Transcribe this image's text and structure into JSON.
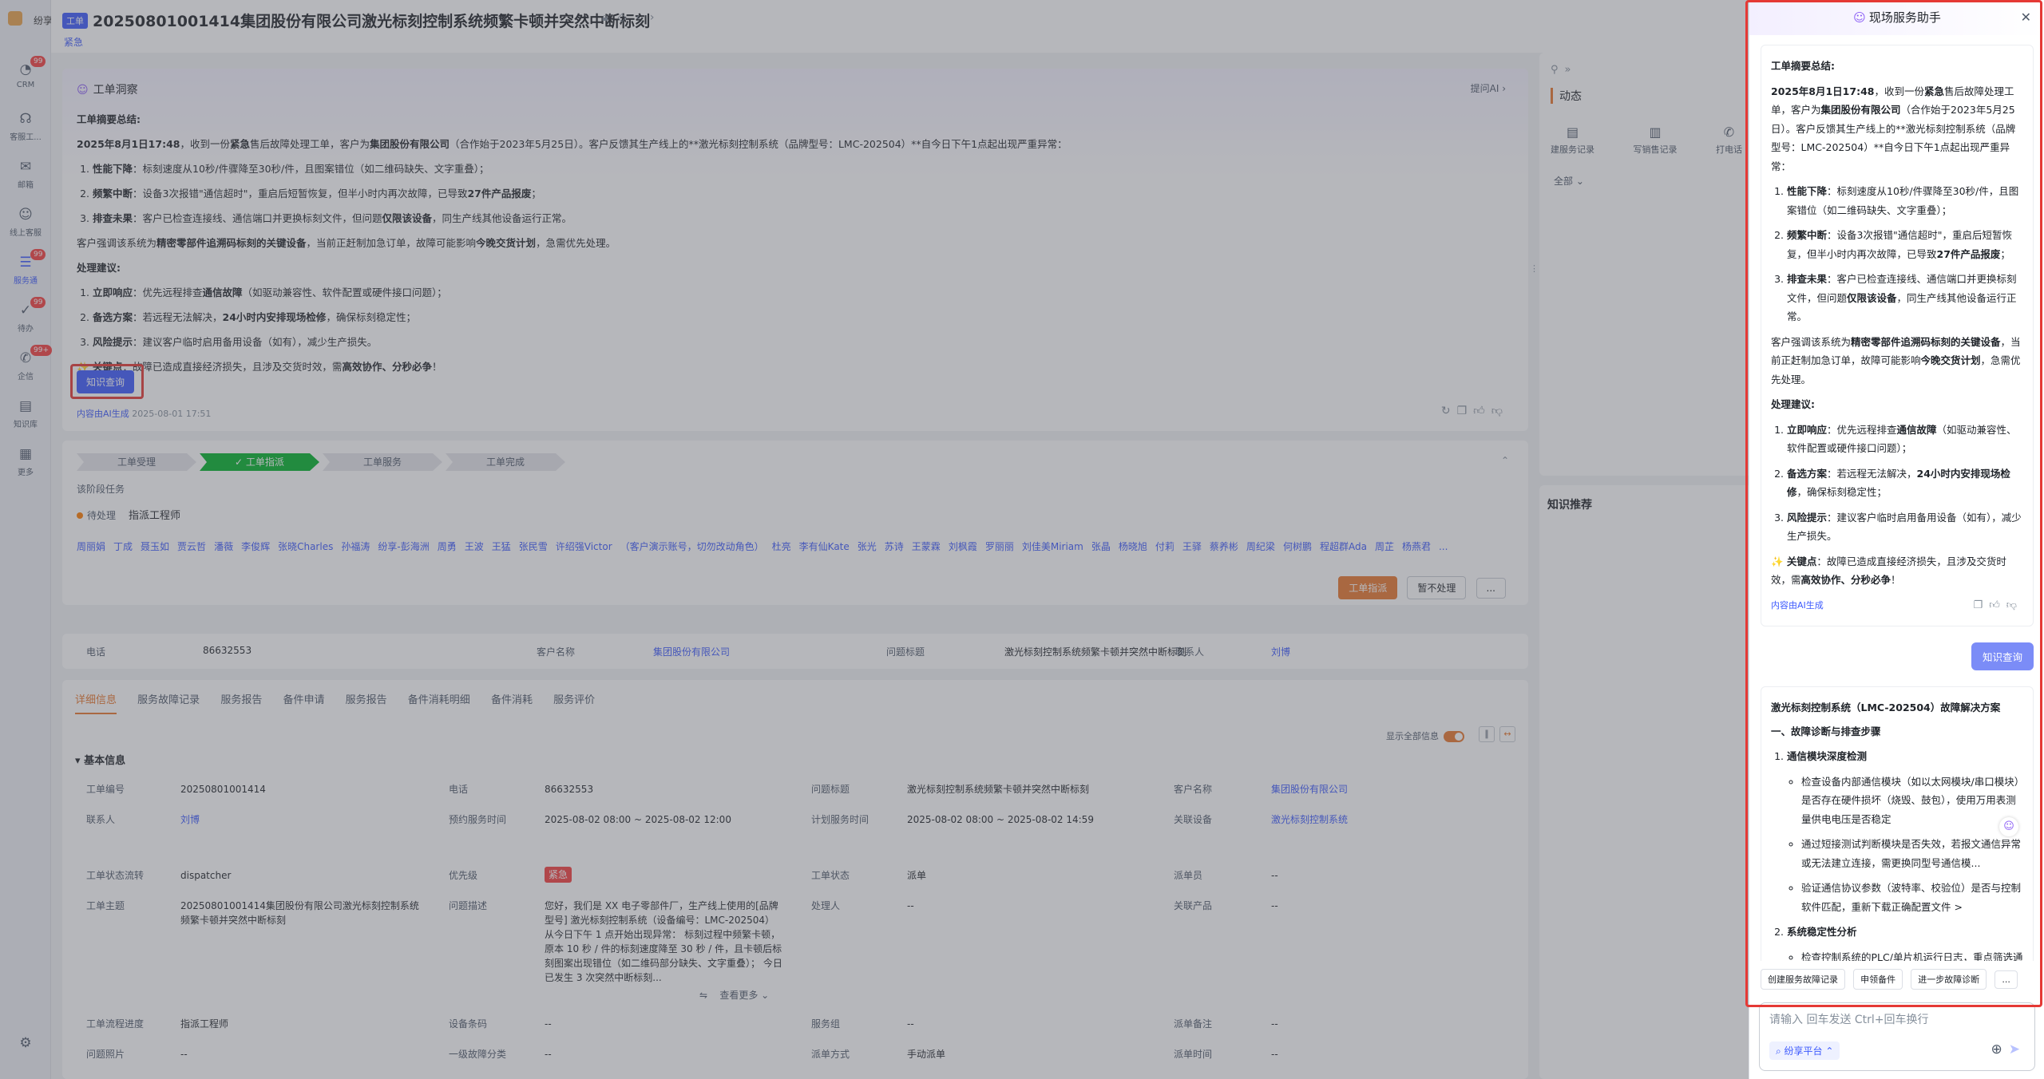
{
  "nav": {
    "brand": "纷享",
    "items": [
      {
        "label": "CRM",
        "icon": "crm-icon",
        "badge": "99"
      },
      {
        "label": "客服工...",
        "icon": "headset-icon",
        "badge": ""
      },
      {
        "label": "邮箱",
        "icon": "mail-icon",
        "badge": ""
      },
      {
        "label": "线上客服",
        "icon": "chat-icon",
        "badge": ""
      },
      {
        "label": "服务通",
        "icon": "service-icon",
        "badge": "99"
      },
      {
        "label": "待办",
        "icon": "todo-icon",
        "badge": "99"
      },
      {
        "label": "企信",
        "icon": "message-icon",
        "badge": "99+"
      },
      {
        "label": "知识库",
        "icon": "book-icon",
        "badge": ""
      },
      {
        "label": "更多",
        "icon": "grid-icon",
        "badge": ""
      }
    ],
    "settings_icon": "gear-icon"
  },
  "header": {
    "tag": "工单",
    "title": "20250801001414集团股份有限公司激光标刻控制系统频繁卡顿并突然中断标刻",
    "priority": "紧急"
  },
  "insight": {
    "heading": "工单洞察",
    "ask_ai": "提问AI",
    "summary_label": "工单摘要总结:",
    "p1_time": "2025年8月1日17:48",
    "p1_a": "，收到一份",
    "p1_urgent": "紧急",
    "p1_b": "售后故障处理工单，客户为",
    "p1_company": "集团股份有限公司",
    "p1_c": "（合作始于2023年5月25日）。客户反馈其生产线上的**激光标刻控制系统（品牌型号：LMC-202504）**自今日下午1点起出现严重异常：",
    "items": [
      {
        "k": "性能下降",
        "t": "：标刻速度从10秒/件骤降至30秒/件，且图案错位（如二维码缺失、文字重叠）；",
        "b": "",
        "t2": ""
      },
      {
        "k": "频繁中断",
        "t": "：设备3次报错\"通信超时\"，重启后短暂恢复，但半小时内再次故障，已导致",
        "b": "27件产品报废",
        "t2": "；"
      },
      {
        "k": "排查未果",
        "t": "：客户已检查连接线、通信端口并更换标刻文件，但问题",
        "b": "仅限该设备",
        "t2": "，同生产线其他设备运行正常。"
      }
    ],
    "p2_a": "客户强调该系统为",
    "p2_b": "精密零部件追溯码标刻的关键设备",
    "p2_c": "，当前正赶制加急订单，故障可能影响",
    "p2_d": "今晚交货计划",
    "p2_e": "，急需优先处理。",
    "advice_label": "处理建议:",
    "advice": [
      {
        "k": "立即响应",
        "t": "：优先远程排查",
        "b": "通信故障",
        "t2": "（如驱动兼容性、软件配置或硬件接口问题）；"
      },
      {
        "k": "备选方案",
        "t": "：若远程无法解决，",
        "b": "24小时内安排现场检修",
        "t2": "，确保标刻稳定性；"
      },
      {
        "k": "风险提示",
        "t": "：建议客户临时启用备用设备（如有），减少生产损失。",
        "b": "",
        "t2": ""
      }
    ],
    "key_a": "✨ 关键点",
    "key_b": "：故障已造成直接经济损失，且涉及交货时效，需",
    "key_c": "高效协作、分秒必争",
    "key_d": "！",
    "kq_button": "知识查询",
    "ai_gen": "内容由AI生成",
    "ai_time": "2025-08-01 17:51"
  },
  "flow": {
    "steps": [
      "工单受理",
      "工单指派",
      "工单服务",
      "工单完成"
    ],
    "current_step": 1,
    "phase_task": "该阶段任务",
    "pending": "待处理",
    "engineer": "指派工程师",
    "people": [
      "周丽娟",
      "丁成",
      "聂玉如",
      "贾云哲",
      "潘薇",
      "李俊辉",
      "张晓Charles",
      "孙福涛",
      "纷享-彭海洲",
      "周勇",
      "王波",
      "王猛",
      "张民雪",
      "许绍强Victor",
      "（客户演示账号，切勿改动角色）",
      "杜亮",
      "李有仙Kate",
      "张光",
      "苏诗",
      "王蒙霖",
      "刘枫霞",
      "罗丽丽",
      "刘佳美Miriam",
      "张晶",
      "杨晓旭",
      "付莉",
      "王驿",
      "蔡养彬",
      "周纪梁",
      "何树鹏",
      "程超群Ada",
      "周芷",
      "杨燕君",
      "..."
    ],
    "btn_assign": "工单指派",
    "btn_pause": "暂不处理",
    "btn_more": "..."
  },
  "infobar": {
    "phone_l": "电话",
    "phone_v": "86632553",
    "cust_l": "客户名称",
    "cust_v": "集团股份有限公司",
    "issue_l": "问题标题",
    "issue_v": "激光标刻控制系统频繁卡顿并突然中断标刻",
    "contact_l": "联系人",
    "contact_v": "刘博"
  },
  "details": {
    "tabs": [
      "详细信息",
      "服务故障记录",
      "服务报告",
      "备件申请",
      "服务报告",
      "备件消耗明细",
      "备件消耗",
      "服务评价"
    ],
    "show_all": "显示全部信息",
    "section": "基本信息",
    "fields": {
      "wo_no_l": "工单编号",
      "wo_no_v": "20250801001414",
      "tel_l": "电话",
      "tel_v": "86632553",
      "title_l": "问题标题",
      "title_v": "激光标刻控制系统频繁卡顿并突然中断标刻",
      "cust_l": "客户名称",
      "cust_v": "集团股份有限公司",
      "contact_l": "联系人",
      "contact_v": "刘博",
      "appt_l": "预约服务时间",
      "appt_v": "2025-08-02 08:00 ~ 2025-08-02 12:00",
      "plan_l": "计划服务时间",
      "plan_v": "2025-08-02 08:00 ~ 2025-08-02 14:59",
      "device_l": "关联设备",
      "device_v": "激光标刻控制系统",
      "flow_l": "工单状态流转",
      "flow_v": "dispatcher",
      "prio_l": "优先级",
      "prio_v": "紧急",
      "status_l": "工单状态",
      "status_v": "派单",
      "dispatcher_l": "派单员",
      "dispatcher_v": "--",
      "subject_l": "工单主题",
      "subject_v": "20250801001414集团股份有限公司激光标刻控制系统频繁卡顿并突然中断标刻",
      "desc_l": "问题描述",
      "desc_v": "您好，我们是 XX 电子零部件厂，生产线上使用的[品牌型号] 激光标刻控制系统（设备编号：LMC-202504）从今日下午 1 点开始出现异常： 标刻过程中频繁卡顿，原本 10 秒 / 件的标刻速度降至 30 秒 / 件，且卡顿后标刻图案出现错位（如二维码部分缺失、文字重叠）；  今日已发生 3 次突然中断标刻...",
      "handler_l": "处理人",
      "handler_v": "--",
      "product_l": "关联产品",
      "product_v": "--",
      "see_more": "查看更多",
      "progress_l": "工单流程进度",
      "progress_v": "指派工程师",
      "barcode_l": "设备条码",
      "barcode_v": "--",
      "group_l": "服务组",
      "group_v": "--",
      "note_l": "派单备注",
      "note_v": "--",
      "photo_l": "问题照片",
      "photo_v": "--",
      "cat_l": "一级故障分类",
      "cat_v": "--",
      "method_l": "派单方式",
      "method_v": "手动派单",
      "dtime_l": "派单时间",
      "dtime_v": "--"
    }
  },
  "side": {
    "title": "动态",
    "actions": [
      "建服务记录",
      "写销售记录",
      "打电话"
    ],
    "filter": "全部",
    "kb_title": "知识推荐"
  },
  "assistant": {
    "title": "现场服务助手",
    "s_label": "工单摘要总结:",
    "s1_time": "2025年8月1日17:48",
    "s1_a": "，收到一份",
    "s1_urgent": "紧急",
    "s1_b": "售后故障处理工单，客户为",
    "s1_company": "集团股份有限公司",
    "s1_c": "（合作始于2023年5月25日）。客户反馈其生产线上的**激光标刻控制系统（品牌型号：LMC-202504）**自今日下午1点起出现严重异常：",
    "user_msg": "知识查询",
    "sol_title": "激光标刻控制系统（LMC-202504）故障解决方案",
    "sol_h1": "一、故障诊断与排查步骤",
    "sol_1": "通信模块深度检测",
    "sol_1a": "检查设备内部通信模块（如以太网模块/串口模块）是否存在硬件损坏（烧毁、鼓包），使用万用表测量供电电压是否稳定",
    "sol_1b": "通过短接测试判断模块是否失效，若报文通信异常或无法建立连接，需更换同型号通信模...",
    "sol_1c": "验证通信协议参数（波特率、校验位）是否与控制软件匹配，重新下载正确配置文件 >",
    "sol_2": "系统稳定性分析",
    "sol_2a": "检查控制系统的PLC/单片机运行日志，重点筛选通信超时错误代码，分析是否为程序死锁或内存溢出导致",
    "quick": [
      "创建服务故障记录",
      "申领备件",
      "进一步故障诊断",
      "..."
    ],
    "input_placeholder": "请输入 回车发送 Ctrl+回车换行",
    "platform": "纷享平台"
  }
}
